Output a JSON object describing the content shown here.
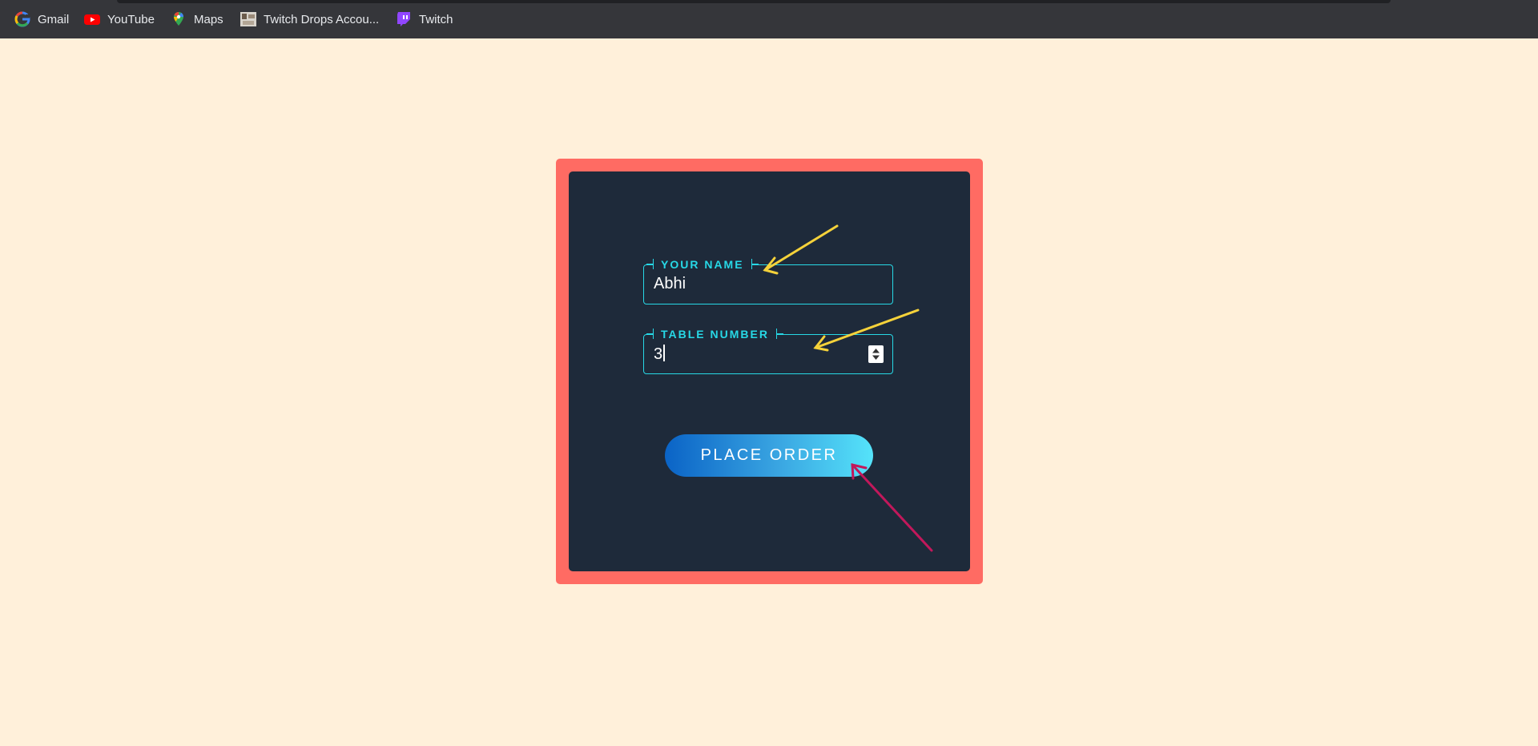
{
  "bookmarks": [
    {
      "label": "Gmail",
      "icon": "google-icon"
    },
    {
      "label": "YouTube",
      "icon": "youtube-icon"
    },
    {
      "label": "Maps",
      "icon": "maps-icon"
    },
    {
      "label": "Twitch Drops Accou...",
      "icon": "twitch-drops-thumbnail-icon"
    },
    {
      "label": "Twitch",
      "icon": "twitch-icon"
    }
  ],
  "form": {
    "name_label": "YOUR NAME",
    "name_value": "Abhi",
    "table_label": "TABLE NUMBER",
    "table_value": "3",
    "submit_label": "PLACE ORDER"
  },
  "colors": {
    "page_background": "#fff0da",
    "card_border": "#ff6b63",
    "card_background": "#1e2a3a",
    "field_accent": "#27d8e6",
    "arrow_yellow": "#f5d23a",
    "arrow_magenta": "#c2185b"
  }
}
